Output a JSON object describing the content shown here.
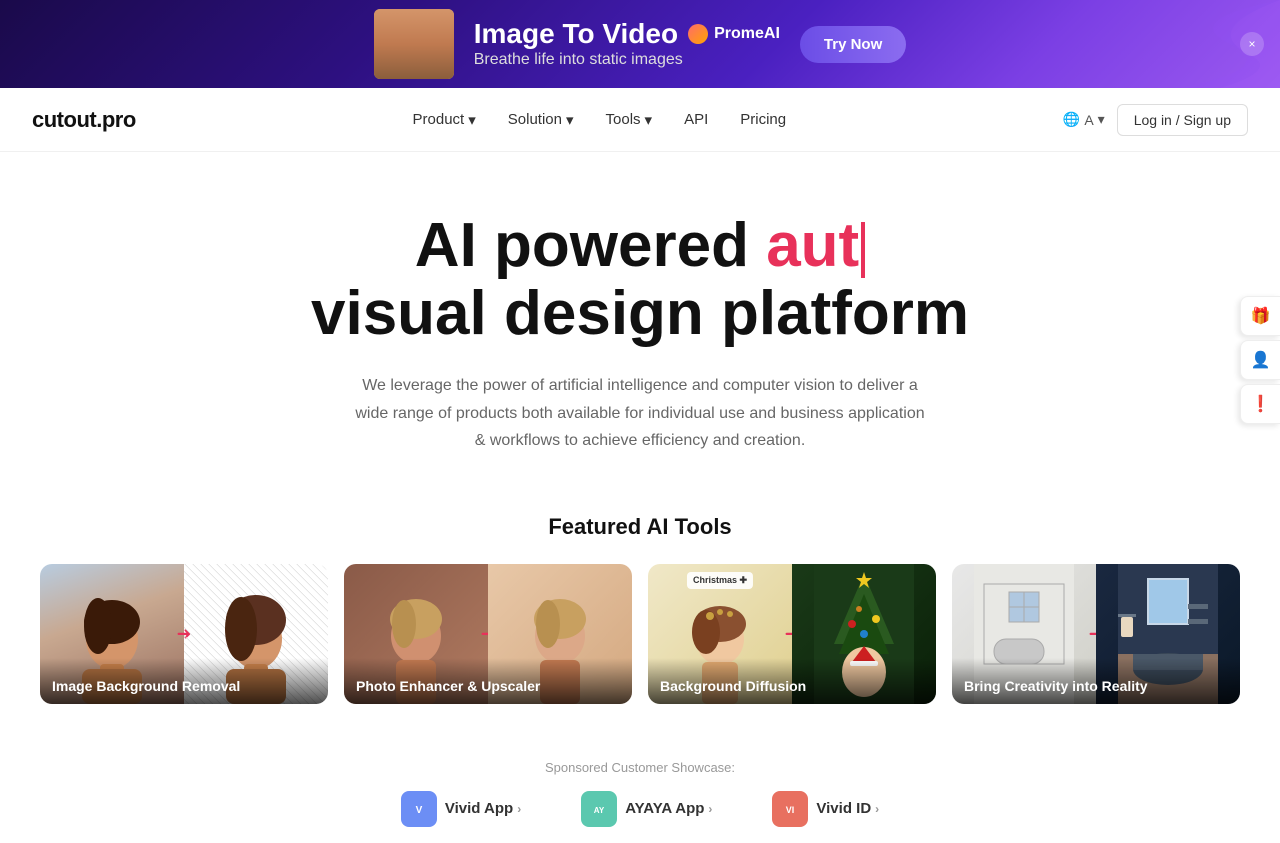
{
  "ad": {
    "title": "Image To Video",
    "brand": "PromeAI",
    "subtitle": "Breathe life into static images",
    "cta_label": "Try Now",
    "close_label": "×"
  },
  "navbar": {
    "logo": "cutout.pro",
    "links": [
      {
        "label": "Product",
        "has_dropdown": true
      },
      {
        "label": "Solution",
        "has_dropdown": true
      },
      {
        "label": "Tools",
        "has_dropdown": true
      },
      {
        "label": "API",
        "has_dropdown": false
      },
      {
        "label": "Pricing",
        "has_dropdown": false
      }
    ],
    "lang_label": "A",
    "auth_label": "Log in / Sign up"
  },
  "hero": {
    "line1": "AI powered ",
    "typed_text": "aut",
    "line2": "visual design platform",
    "description": "We leverage the power of artificial intelligence and computer vision to deliver a wide range of products both available for individual use and business application & workflows to achieve efficiency and creation."
  },
  "featured": {
    "section_title": "Featured AI Tools",
    "tools": [
      {
        "id": "bg-removal",
        "label": "Image Background Removal",
        "theme": "removal"
      },
      {
        "id": "enhancer",
        "label": "Photo Enhancer & Upscaler",
        "theme": "enhancer"
      },
      {
        "id": "bg-diffusion",
        "label": "Background Diffusion",
        "theme": "diffusion"
      },
      {
        "id": "creativity",
        "label": "Bring Creativity into Reality",
        "theme": "creativity"
      }
    ]
  },
  "sponsored": {
    "label": "Sponsored Customer Showcase:",
    "sponsors": [
      {
        "name": "Vivid App",
        "icon_color": "#6c8ef5",
        "arrow": ">"
      },
      {
        "name": "AYAYA App",
        "icon_color": "#5bc8af",
        "arrow": ">"
      },
      {
        "name": "Vivid ID",
        "icon_color": "#e87060",
        "arrow": ">"
      }
    ]
  },
  "side_buttons": [
    {
      "id": "gift",
      "icon": "🎁"
    },
    {
      "id": "user",
      "icon": "👤"
    },
    {
      "id": "info",
      "icon": "❗"
    }
  ]
}
